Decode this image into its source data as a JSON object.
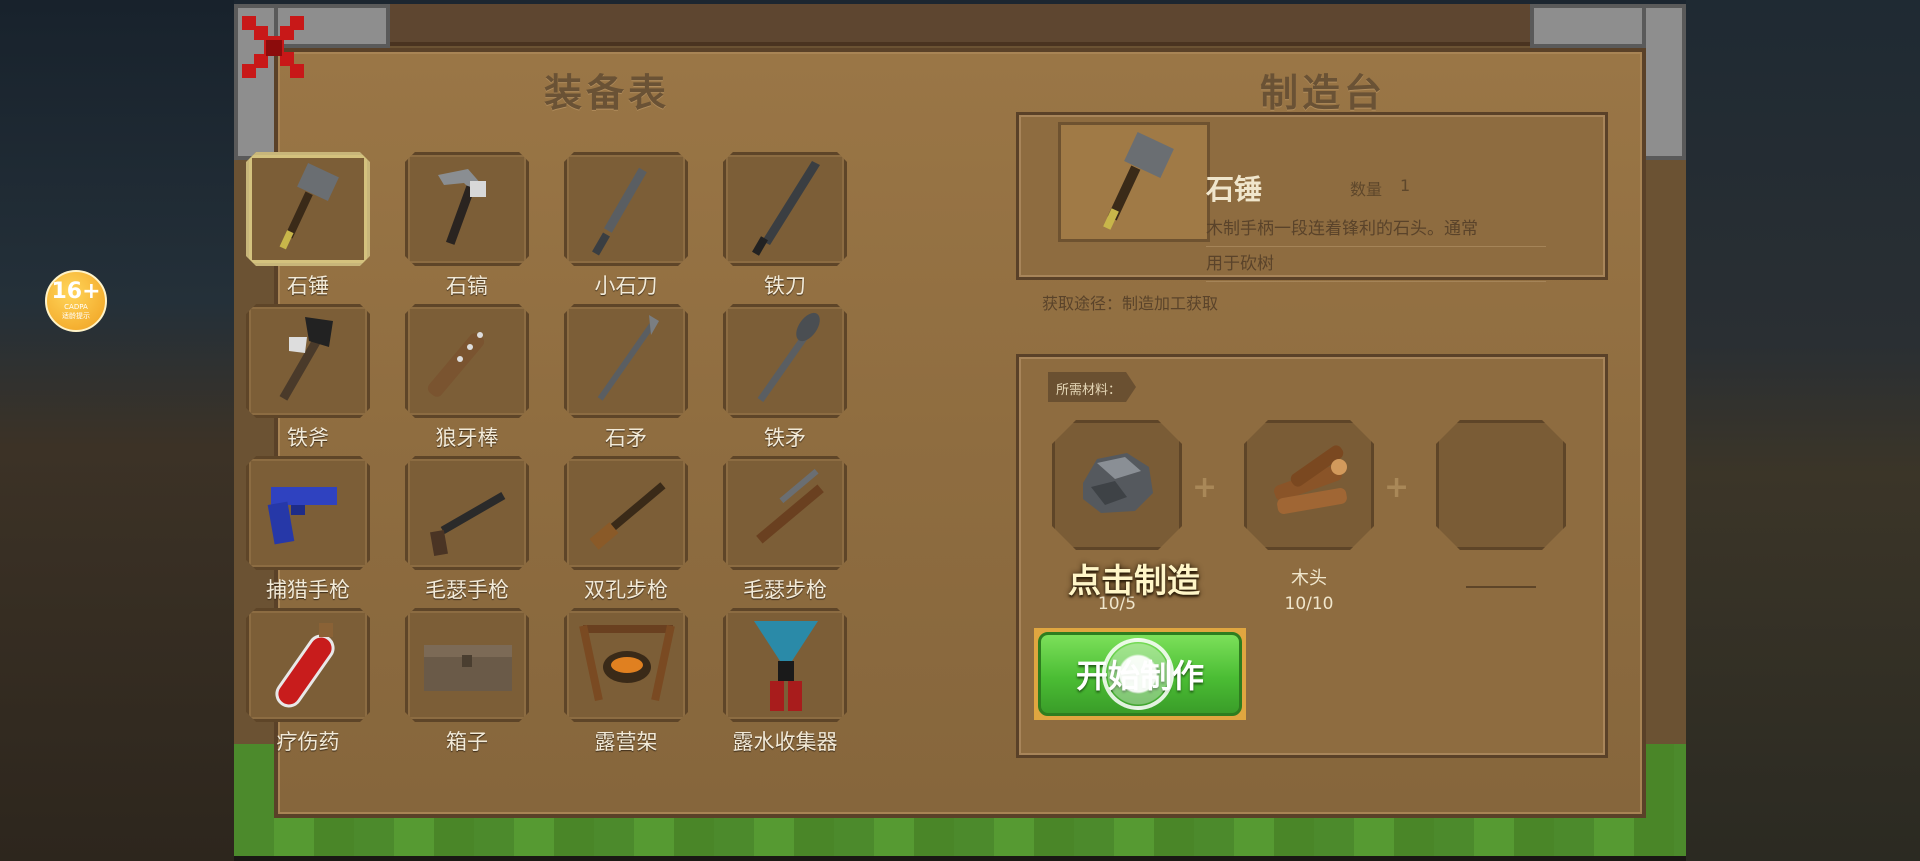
{
  "badge": {
    "age": "16+",
    "line1": "CADPA",
    "line2": "适龄提示"
  },
  "close_icon": "close-x-icon",
  "titles": {
    "equipment": "装备表",
    "workbench": "制造台"
  },
  "items": [
    {
      "name": "石锤",
      "icon": "stone-hammer-icon",
      "selected": true
    },
    {
      "name": "石镐",
      "icon": "stone-pickaxe-icon"
    },
    {
      "name": "小石刀",
      "icon": "small-stone-knife-icon"
    },
    {
      "name": "铁刀",
      "icon": "iron-sword-icon"
    },
    {
      "name": "铁斧",
      "icon": "iron-axe-icon"
    },
    {
      "name": "狼牙棒",
      "icon": "spiked-club-icon"
    },
    {
      "name": "石矛",
      "icon": "stone-spear-icon"
    },
    {
      "name": "铁矛",
      "icon": "iron-spear-icon"
    },
    {
      "name": "捕猎手枪",
      "icon": "hunting-pistol-icon"
    },
    {
      "name": "毛瑟手枪",
      "icon": "mauser-pistol-icon"
    },
    {
      "name": "双孔步枪",
      "icon": "double-barrel-rifle-icon"
    },
    {
      "name": "毛瑟步枪",
      "icon": "mauser-rifle-icon"
    },
    {
      "name": "疗伤药",
      "icon": "healing-potion-icon"
    },
    {
      "name": "箱子",
      "icon": "chest-icon"
    },
    {
      "name": "露营架",
      "icon": "campfire-rack-icon"
    },
    {
      "name": "露水收集器",
      "icon": "dew-collector-icon"
    }
  ],
  "selected_item": {
    "name": "石锤",
    "qty_label": "数量",
    "qty": "1",
    "desc_line1": "木制手柄一段连着锋利的石头。通常",
    "desc_line2": "用于砍树",
    "source": "获取途径：制造加工获取"
  },
  "materials": {
    "tag": "所需材料：",
    "slots": [
      {
        "icon": "stone-icon",
        "name": "",
        "count": "10/5"
      },
      {
        "icon": "wood-log-icon",
        "name": "木头",
        "count": "10/10"
      },
      {
        "icon": "empty-slot",
        "name": "",
        "count": ""
      }
    ]
  },
  "hint": "点击制造",
  "make_button": "开始制作",
  "colors": {
    "panel": "#8f6d40",
    "button": "#4bbd34",
    "hint": "#fff6c8"
  }
}
